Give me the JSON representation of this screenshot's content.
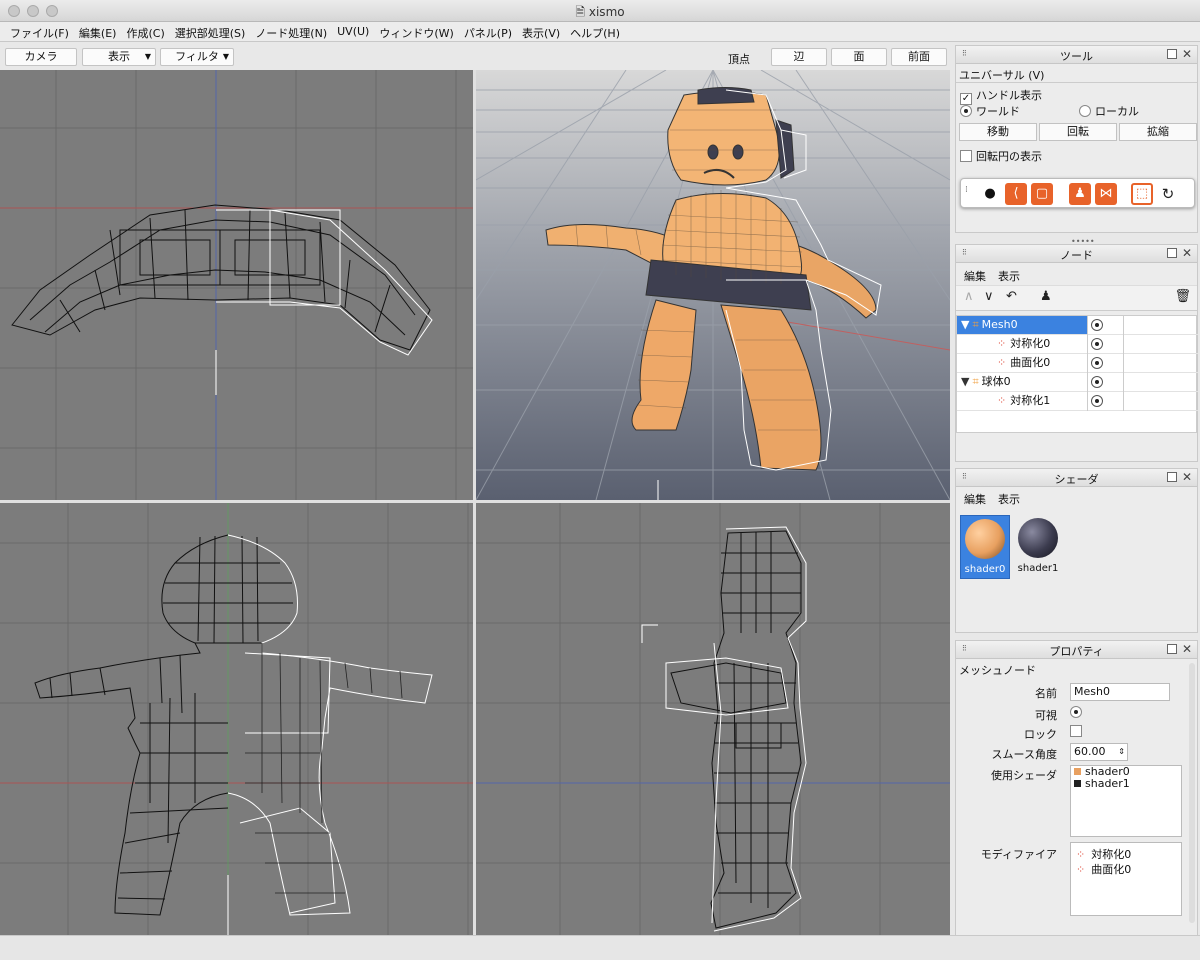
{
  "window": {
    "title": "xismo"
  },
  "menu": [
    "ファイル(F)",
    "編集(E)",
    "作成(C)",
    "選択部処理(S)",
    "ノード処理(N)",
    "UV(U)",
    "ウィンドウ(W)",
    "パネル(P)",
    "表示(V)",
    "ヘルプ(H)"
  ],
  "viewport_toolbar": {
    "camera": "カメラ",
    "display": "表示",
    "filter": "フィルタ",
    "mode_label": "頂点",
    "edge": "辺",
    "face": "面",
    "front": "前面"
  },
  "tool_panel": {
    "title": "ツール",
    "mode": "ユニバーサル (V)",
    "show_handles": "ハンドル表示",
    "world": "ワールド",
    "local": "ローカル",
    "move": "移動",
    "rotate": "回転",
    "scale": "拡縮",
    "show_rotation_circle": "回転円の表示"
  },
  "node_panel": {
    "title": "ノード",
    "menu_edit": "編集",
    "menu_view": "表示",
    "nodes": [
      {
        "name": "Mesh0",
        "level": 0,
        "expanded": true,
        "selected": true
      },
      {
        "name": "対称化0",
        "level": 1
      },
      {
        "name": "曲面化0",
        "level": 1
      },
      {
        "name": "球体0",
        "level": 0,
        "expanded": true
      },
      {
        "name": "対称化1",
        "level": 1
      }
    ]
  },
  "shader_panel": {
    "title": "シェーダ",
    "menu_edit": "編集",
    "menu_view": "表示",
    "shaders": [
      {
        "name": "shader0",
        "color": "#e8a060",
        "selected": true
      },
      {
        "name": "shader1",
        "color": "#3b3b4e"
      }
    ]
  },
  "property_panel": {
    "title": "プロパティ",
    "section": "メッシュノード",
    "name_label": "名前",
    "name_value": "Mesh0",
    "visible_label": "可視",
    "lock_label": "ロック",
    "smooth_label": "スムース角度",
    "smooth_value": "60.00",
    "shaders_label": "使用シェーダ",
    "shaders_used": [
      "shader0",
      "shader1"
    ],
    "modifiers_label": "モディファイア",
    "modifiers": [
      "対称化0",
      "曲面化0"
    ]
  },
  "colors": {
    "selection": "#3b82e0",
    "accent_orange": "#e8632a",
    "viewport_bg": "#7c7c7c"
  }
}
